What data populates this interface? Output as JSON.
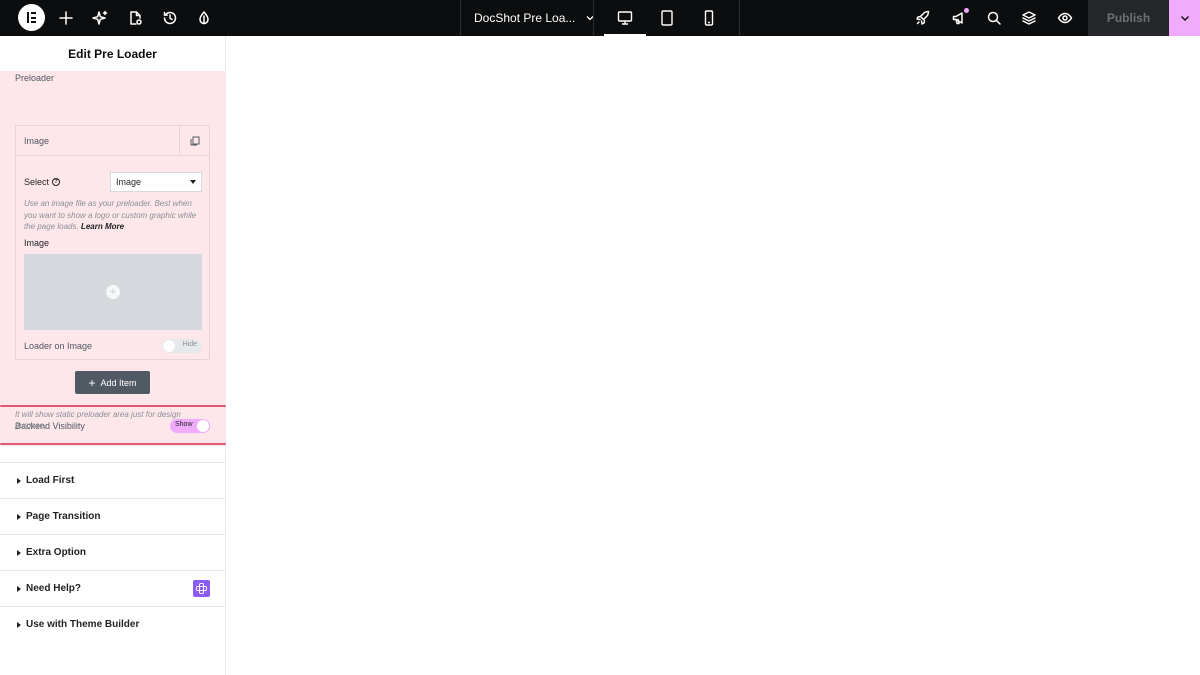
{
  "topbar": {
    "document_title": "DocShot Pre Loa...",
    "publish_label": "Publish",
    "tools": [
      "add-icon",
      "ai-sparkle-icon",
      "page-settings-icon",
      "history-icon",
      "site-settings-icon"
    ],
    "right_tools": [
      "rocket-icon",
      "announcements-icon",
      "search-icon",
      "structure-layers-icon",
      "preview-eye-icon"
    ],
    "devices": [
      "desktop",
      "tablet",
      "mobile"
    ],
    "active_device": "desktop",
    "colors": {
      "bar": "#0c0d0e",
      "accent": "#f0abfc"
    }
  },
  "panel": {
    "title": "Edit Pre Loader",
    "section_label": "Preloader",
    "repeater": {
      "item_title": "Image",
      "select_label": "Select",
      "select_value": "Image",
      "description": "Use an image file as your preloader. Best when you want to show a logo or custom graphic while the page loads.",
      "learn_more": "Learn More",
      "image_label": "Image",
      "loader_on_image_label": "Loader on Image",
      "loader_on_image_state": "Hide"
    },
    "add_item_label": "Add Item",
    "backend_visibility_label": "Backend Visibility",
    "backend_visibility_state": "Show",
    "backend_visibility_desc": "It will show static preloader area just for design purpose.",
    "accordions": [
      {
        "label": "Load First"
      },
      {
        "label": "Page Transition"
      },
      {
        "label": "Extra Option"
      },
      {
        "label": "Need Help?"
      },
      {
        "label": "Use with Theme Builder"
      }
    ]
  }
}
